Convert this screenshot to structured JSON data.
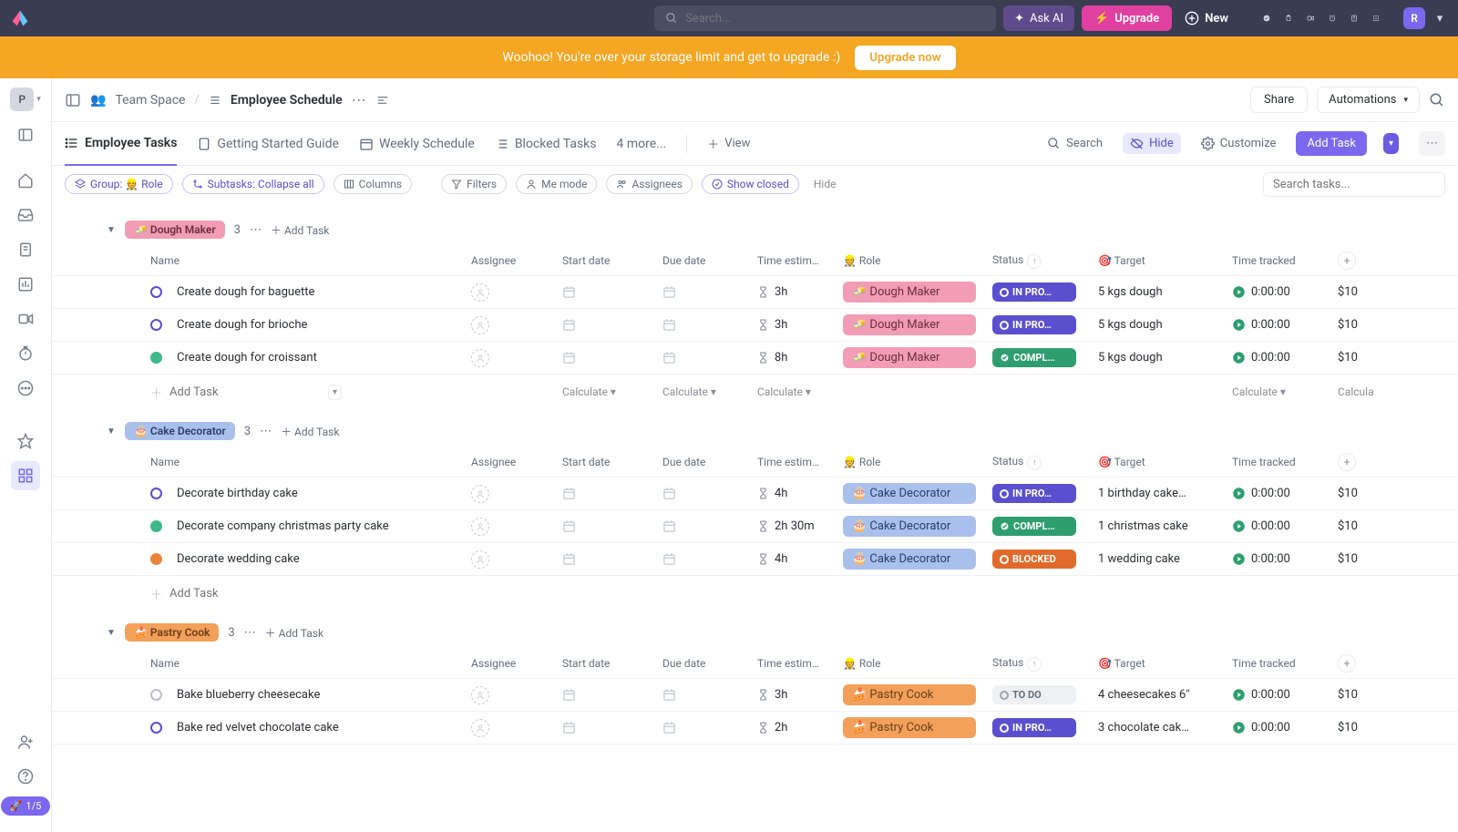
{
  "topbar": {
    "search_placeholder": "Search...",
    "ask_ai": "Ask AI",
    "upgrade": "Upgrade",
    "new": "New",
    "avatar": "R"
  },
  "banner": {
    "text": "Woohoo! You're over your storage limit and get to upgrade :)",
    "cta": "Upgrade now"
  },
  "sidebar": {
    "workspace_initial": "P",
    "onboard": "1/5"
  },
  "breadcrumb": {
    "space": "Team Space",
    "page": "Employee Schedule",
    "share": "Share",
    "automations": "Automations"
  },
  "tabs": {
    "employee": "Employee Tasks",
    "getting_started": "Getting Started Guide",
    "weekly": "Weekly Schedule",
    "blocked": "Blocked Tasks",
    "more": "4 more...",
    "view": "View",
    "search": "Search",
    "hide": "Hide",
    "customize": "Customize",
    "add_task": "Add Task"
  },
  "filters": {
    "group": "Group: 👷 Role",
    "subtasks": "Subtasks: Collapse all",
    "columns": "Columns",
    "filters": "Filters",
    "me": "Me mode",
    "assignees": "Assignees",
    "show_closed": "Show closed",
    "hide": "Hide",
    "search_placeholder": "Search tasks..."
  },
  "columns": {
    "name": "Name",
    "assignee": "Assignee",
    "start": "Start date",
    "due": "Due date",
    "time": "Time estim…",
    "role": "Role",
    "status": "Status",
    "target": "Target",
    "tracked": "Time tracked"
  },
  "role_icon": "👷",
  "target_icon": "🎯",
  "footer": {
    "add_task": "Add Task",
    "calculate": "Calculate"
  },
  "cost": "$10",
  "groups": [
    {
      "label": "Dough Maker",
      "emoji": "🧈",
      "chip_class": "role-dough",
      "count": "3",
      "tasks": [
        {
          "name": "Create dough for baguette",
          "dot": "inprog",
          "time": "3h",
          "role": "Dough Maker",
          "role_emoji": "🧈",
          "role_class": "role-dough",
          "status": "IN PRO…",
          "status_class": "inprog",
          "target": "5 kgs dough",
          "tracked": "0:00:00"
        },
        {
          "name": "Create dough for brioche",
          "dot": "inprog",
          "time": "3h",
          "role": "Dough Maker",
          "role_emoji": "🧈",
          "role_class": "role-dough",
          "status": "IN PRO…",
          "status_class": "inprog",
          "target": "5 kgs dough",
          "tracked": "0:00:00"
        },
        {
          "name": "Create dough for croissant",
          "dot": "complete",
          "time": "8h",
          "role": "Dough Maker",
          "role_emoji": "🧈",
          "role_class": "role-dough",
          "status": "COMPL…",
          "status_class": "complete",
          "target": "5 kgs dough",
          "tracked": "0:00:00"
        }
      ],
      "show_footer_calc": true
    },
    {
      "label": "Cake Decorator",
      "emoji": "🎂",
      "chip_class": "role-cake",
      "count": "3",
      "tasks": [
        {
          "name": "Decorate birthday cake",
          "dot": "inprog",
          "time": "4h",
          "role": "Cake Decorator",
          "role_emoji": "🎂",
          "role_class": "role-cake",
          "status": "IN PRO…",
          "status_class": "inprog",
          "target": "1 birthday cake…",
          "tracked": "0:00:00"
        },
        {
          "name": "Decorate company christmas party cake",
          "dot": "complete",
          "time": "2h 30m",
          "role": "Cake Decorator",
          "role_emoji": "🎂",
          "role_class": "role-cake",
          "status": "COMPL…",
          "status_class": "complete",
          "target": "1 christmas cake",
          "tracked": "0:00:00"
        },
        {
          "name": "Decorate wedding cake",
          "dot": "blocked",
          "time": "4h",
          "role": "Cake Decorator",
          "role_emoji": "🎂",
          "role_class": "role-cake",
          "status": "BLOCKED",
          "status_class": "blocked",
          "target": "1 wedding cake",
          "tracked": "0:00:00"
        }
      ],
      "show_footer_calc": false
    },
    {
      "label": "Pastry Cook",
      "emoji": "🍰",
      "chip_class": "role-pastry",
      "count": "3",
      "tasks": [
        {
          "name": "Bake blueberry cheesecake",
          "dot": "todo",
          "time": "3h",
          "role": "Pastry Cook",
          "role_emoji": "🍰",
          "role_class": "role-pastry",
          "status": "TO DO",
          "status_class": "todo",
          "target": "4 cheesecakes 6\"",
          "tracked": "0:00:00"
        },
        {
          "name": "Bake red velvet chocolate cake",
          "dot": "inprog",
          "time": "2h",
          "role": "Pastry Cook",
          "role_emoji": "🍰",
          "role_class": "role-pastry",
          "status": "IN PRO…",
          "status_class": "inprog",
          "target": "3 chocolate cak…",
          "tracked": "0:00:00"
        }
      ],
      "show_footer_calc": false,
      "hide_footer": true
    }
  ]
}
